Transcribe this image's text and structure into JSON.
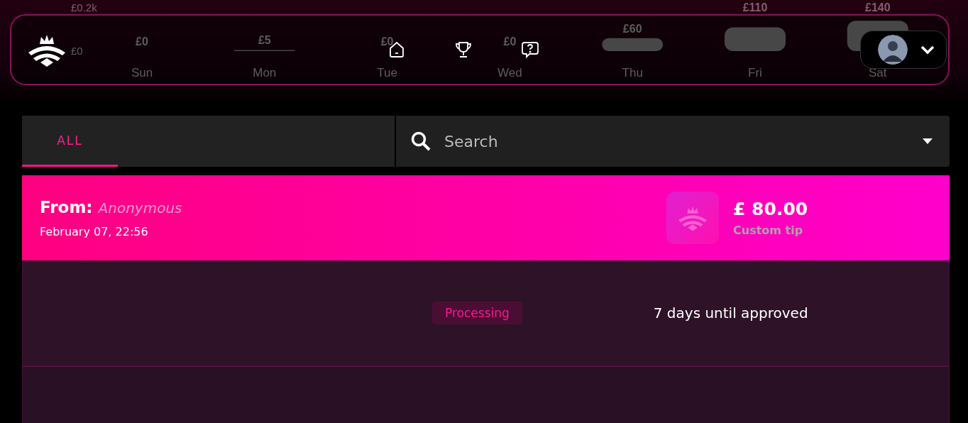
{
  "chart": {
    "chart_data": {
      "type": "bar",
      "categories": [
        "Sun",
        "Mon",
        "Tue",
        "Wed",
        "Thu",
        "Fri",
        "Sat"
      ],
      "values": [
        0,
        5,
        0,
        0,
        60,
        110,
        140
      ],
      "ylim": [
        0,
        200
      ],
      "yticks": [
        {
          "value": 0,
          "label": "£0"
        },
        {
          "value": 200,
          "label": "£0.2k"
        }
      ],
      "value_labels": [
        "£0",
        "£5",
        "£0",
        "£0",
        "£60",
        "£110",
        "£140"
      ]
    }
  },
  "tabs": [
    {
      "label": "ALL",
      "selected": true
    }
  ],
  "search": {
    "placeholder": "Search"
  },
  "transactions": [
    {
      "from_label": "From:",
      "from": "Anonymous",
      "date": "February 07, 22:56",
      "amount": "£ 80.00",
      "type": "Custom tip",
      "status": "Processing",
      "note": "7 days until approved"
    }
  ]
}
